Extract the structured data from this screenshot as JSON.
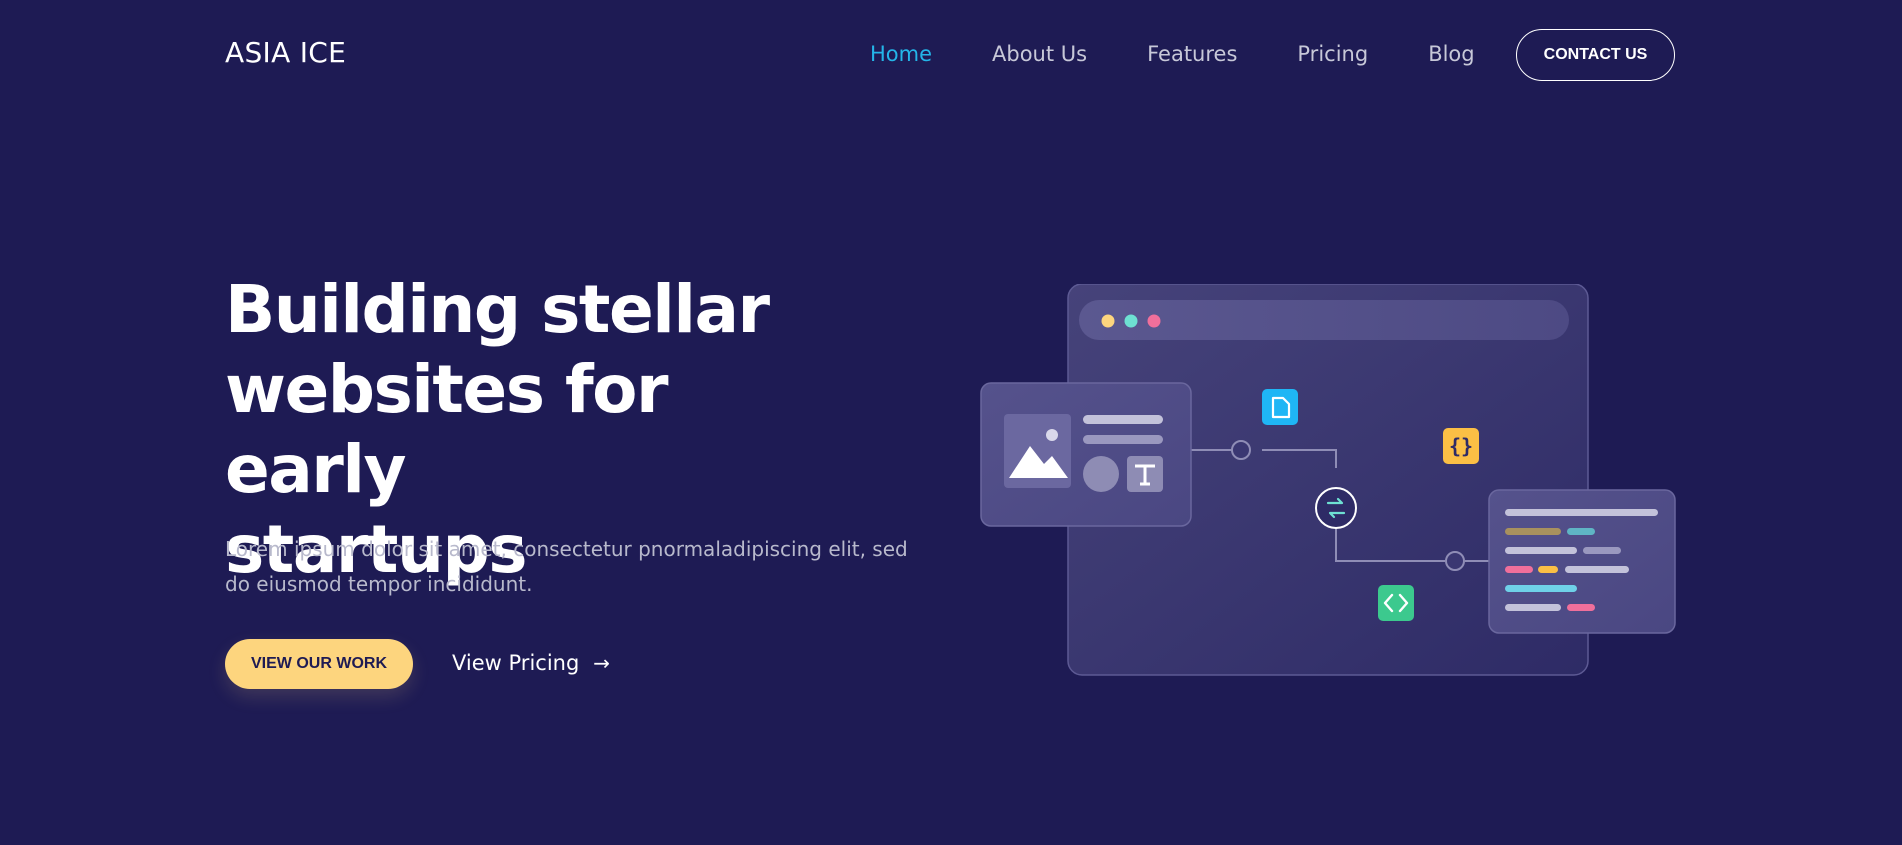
{
  "header": {
    "brand": "ASIA ICE",
    "nav": [
      {
        "label": "Home",
        "active": true
      },
      {
        "label": "About Us",
        "active": false
      },
      {
        "label": "Features",
        "active": false
      },
      {
        "label": "Pricing",
        "active": false
      },
      {
        "label": "Blog",
        "active": false
      }
    ],
    "contact_label": "CONTACT US"
  },
  "hero": {
    "title_line1": "Building stellar",
    "title_line2": "websites for early",
    "title_line3": "startups",
    "description_line1": "Lorem ipsum dolor sit amet, consectetur pnormaladipiscing elit, sed",
    "description_line2": "do eiusmod tempor incididunt.",
    "primary_cta": "VIEW OUR WORK",
    "secondary_cta": "View Pricing",
    "secondary_cta_icon": "arrow-right-icon"
  },
  "illustration": {
    "window_dots": [
      "#fdd57e",
      "#6ee0d2",
      "#f06f9b"
    ],
    "icons": [
      "image-icon",
      "text-icon",
      "file-icon",
      "sync-icon",
      "braces-icon",
      "code-icon"
    ],
    "braces_glyph": "{}",
    "accent_colors": {
      "file": "#1fb6f5",
      "braces": "#fbbf45",
      "code": "#3cc98e"
    }
  },
  "theme": {
    "background": "#1e1b54",
    "accent": "#24b5e8",
    "cta": "#fdd57e"
  }
}
